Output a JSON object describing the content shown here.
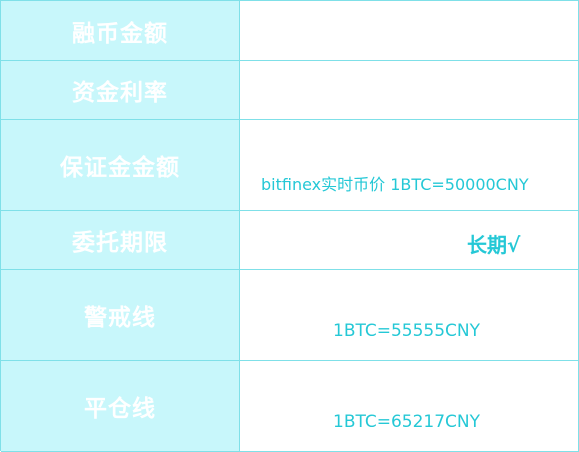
{
  "rows": [
    {
      "label": "融币金额",
      "value": ""
    },
    {
      "label": "资金利率",
      "value": ""
    },
    {
      "label": "保证金金额",
      "value": "bitfinex实时币价  1BTC=50000CNY"
    },
    {
      "label": "委托期限",
      "value": "长期√"
    },
    {
      "label": "警戒线",
      "value": "1BTC=55555CNY"
    },
    {
      "label": "平仓线",
      "value": "1BTC=65217CNY"
    }
  ],
  "colors": {
    "label_background": "#c8f7fb",
    "label_text": "#ffffff",
    "value_text": "#25c8d6",
    "border": "#7fe0e8"
  }
}
